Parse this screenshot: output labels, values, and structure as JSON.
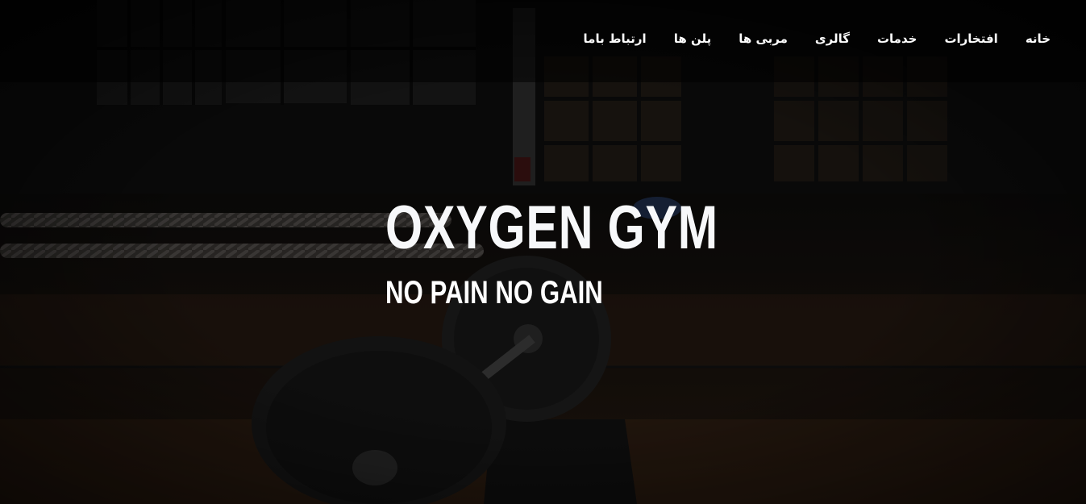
{
  "nav": {
    "items": [
      {
        "label": "خانه"
      },
      {
        "label": "افتخارات"
      },
      {
        "label": "خدمات"
      },
      {
        "label": "گالری"
      },
      {
        "label": "مربی ها"
      },
      {
        "label": "پلن ها"
      },
      {
        "label": "ارتباط باما"
      }
    ]
  },
  "hero": {
    "title": "OXYGEN GYM",
    "tagline": "NO PAIN NO GAIN"
  },
  "colors": {
    "overlay": "#000000",
    "text": "#ffffff"
  }
}
